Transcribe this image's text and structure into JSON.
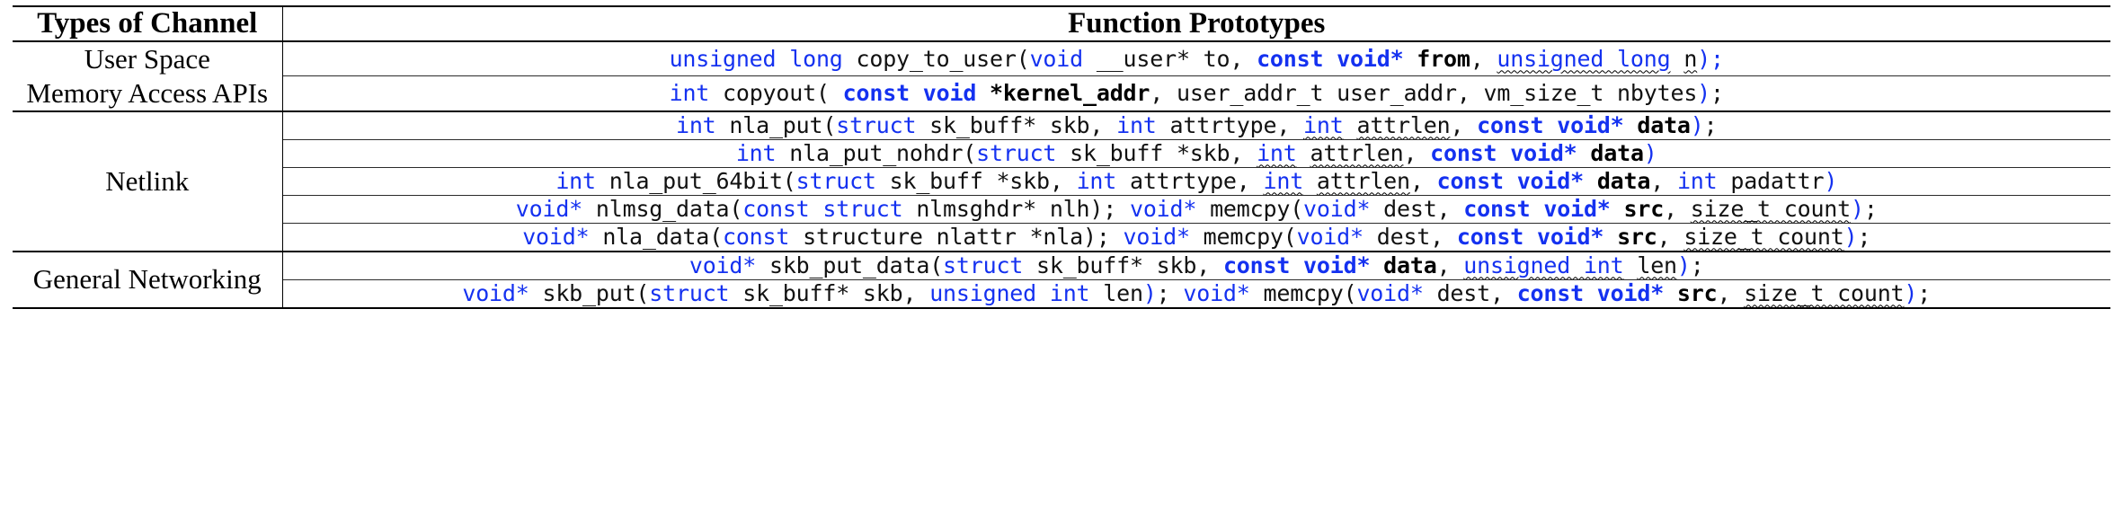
{
  "table": {
    "header": {
      "col_type": "Types of Channel",
      "col_proto": "Function Prototypes"
    },
    "colors": {
      "keyword_blue": "#1431f0",
      "text_black": "#111111",
      "rule": "#000000"
    },
    "groups": [
      {
        "label": "User Space\nMemory Access APIs",
        "label_line1": "User Space",
        "label_line2": "Memory Access APIs",
        "rows": [
          {
            "plain": "unsigned long copy_to_user(void __user* to, const void* from, unsigned long n);",
            "tokens": [
              {
                "t": "unsigned long ",
                "s": "kw"
              },
              {
                "t": "copy_to_user(",
                "s": "pl"
              },
              {
                "t": "void",
                "s": "kw"
              },
              {
                "t": " __user* to, ",
                "s": "pl"
              },
              {
                "t": "const void*",
                "s": "kwb"
              },
              {
                "t": " ",
                "s": "pl"
              },
              {
                "t": "from",
                "s": "bk"
              },
              {
                "t": ", ",
                "s": "pl"
              },
              {
                "t": "unsigned long",
                "s": "kw sq"
              },
              {
                "t": " ",
                "s": "pl"
              },
              {
                "t": "n",
                "s": "pl sq"
              },
              {
                "t": ");",
                "s": "kw"
              }
            ]
          },
          {
            "plain": "int copyout( const void *kernel_addr, user_addr_t user_addr, vm_size_t nbytes);",
            "tokens": [
              {
                "t": "int",
                "s": "kw"
              },
              {
                "t": " copyout( ",
                "s": "pl"
              },
              {
                "t": "const void",
                "s": "kwb"
              },
              {
                "t": " ",
                "s": "pl"
              },
              {
                "t": "*kernel_addr",
                "s": "bk"
              },
              {
                "t": ", user_addr_t user_addr, vm_size_t nbytes",
                "s": "pl"
              },
              {
                "t": ")",
                "s": "kw"
              },
              {
                "t": ";",
                "s": "pl"
              }
            ]
          }
        ]
      },
      {
        "label": "Netlink",
        "label_line1": "Netlink",
        "label_line2": "",
        "rows": [
          {
            "plain": "int nla_put(struct sk_buff* skb, int attrtype, int attrlen, const void* data);",
            "tokens": [
              {
                "t": "int",
                "s": "kw"
              },
              {
                "t": " nla_put(",
                "s": "pl"
              },
              {
                "t": "struct",
                "s": "kw"
              },
              {
                "t": " sk_buff* skb, ",
                "s": "pl"
              },
              {
                "t": "int",
                "s": "kw"
              },
              {
                "t": " attrtype, ",
                "s": "pl"
              },
              {
                "t": "int",
                "s": "kw sq"
              },
              {
                "t": " ",
                "s": "pl"
              },
              {
                "t": "attrlen",
                "s": "pl sq"
              },
              {
                "t": ", ",
                "s": "pl"
              },
              {
                "t": "const void*",
                "s": "kwb"
              },
              {
                "t": " ",
                "s": "pl"
              },
              {
                "t": "data",
                "s": "bk"
              },
              {
                "t": ")",
                "s": "kw"
              },
              {
                "t": ";",
                "s": "pl"
              }
            ]
          },
          {
            "plain": "int nla_put_nohdr(struct sk_buff *skb, int attrlen, const void* data)",
            "tokens": [
              {
                "t": "int",
                "s": "kw"
              },
              {
                "t": " nla_put_nohdr(",
                "s": "pl"
              },
              {
                "t": "struct",
                "s": "kw"
              },
              {
                "t": " sk_buff *skb, ",
                "s": "pl"
              },
              {
                "t": "int",
                "s": "kw sq"
              },
              {
                "t": " ",
                "s": "pl"
              },
              {
                "t": "attrlen",
                "s": "pl sq"
              },
              {
                "t": ", ",
                "s": "pl"
              },
              {
                "t": "const void*",
                "s": "kwb"
              },
              {
                "t": " ",
                "s": "pl"
              },
              {
                "t": "data",
                "s": "bk"
              },
              {
                "t": ")",
                "s": "kw"
              }
            ]
          },
          {
            "plain": "int nla_put_64bit(struct sk_buff *skb, int attrtype, int attrlen, const void* data, int padattr)",
            "tokens": [
              {
                "t": "int",
                "s": "kw"
              },
              {
                "t": " nla_put_64bit(",
                "s": "pl"
              },
              {
                "t": "struct",
                "s": "kw"
              },
              {
                "t": " sk_buff *skb, ",
                "s": "pl"
              },
              {
                "t": "int",
                "s": "kw"
              },
              {
                "t": " attrtype, ",
                "s": "pl"
              },
              {
                "t": "int",
                "s": "kw sq"
              },
              {
                "t": " ",
                "s": "pl"
              },
              {
                "t": "attrlen",
                "s": "pl sq"
              },
              {
                "t": ", ",
                "s": "pl"
              },
              {
                "t": "const void*",
                "s": "kwb"
              },
              {
                "t": " ",
                "s": "pl"
              },
              {
                "t": "data",
                "s": "bk"
              },
              {
                "t": ", ",
                "s": "pl"
              },
              {
                "t": "int",
                "s": "kw"
              },
              {
                "t": " padattr",
                "s": "pl"
              },
              {
                "t": ")",
                "s": "kw"
              }
            ]
          },
          {
            "plain": "void* nlmsg_data(const struct nlmsghdr* nlh); void* memcpy(void* dest, const void* src, size_t count);",
            "tokens": [
              {
                "t": "void*",
                "s": "kw"
              },
              {
                "t": " nlmsg_data(",
                "s": "pl"
              },
              {
                "t": "const struct",
                "s": "kw"
              },
              {
                "t": " nlmsghdr* nlh); ",
                "s": "pl"
              },
              {
                "t": "void*",
                "s": "kw"
              },
              {
                "t": " memcpy(",
                "s": "pl"
              },
              {
                "t": "void*",
                "s": "kw"
              },
              {
                "t": " dest, ",
                "s": "pl"
              },
              {
                "t": "const void*",
                "s": "kwb"
              },
              {
                "t": " ",
                "s": "pl"
              },
              {
                "t": "src",
                "s": "bk"
              },
              {
                "t": ", ",
                "s": "pl"
              },
              {
                "t": "size_t count",
                "s": "pl sq"
              },
              {
                "t": ")",
                "s": "kw"
              },
              {
                "t": ";",
                "s": "pl"
              }
            ]
          },
          {
            "plain": "void* nla_data(const structure nlattr *nla); void* memcpy(void* dest, const void* src, size_t count);",
            "tokens": [
              {
                "t": "void*",
                "s": "kw"
              },
              {
                "t": " nla_data(",
                "s": "pl"
              },
              {
                "t": "const",
                "s": "kw"
              },
              {
                "t": " structure nlattr *nla); ",
                "s": "pl"
              },
              {
                "t": "void*",
                "s": "kw"
              },
              {
                "t": " memcpy(",
                "s": "pl"
              },
              {
                "t": "void*",
                "s": "kw"
              },
              {
                "t": " dest, ",
                "s": "pl"
              },
              {
                "t": "const void*",
                "s": "kwb"
              },
              {
                "t": " ",
                "s": "pl"
              },
              {
                "t": "src",
                "s": "bk"
              },
              {
                "t": ", ",
                "s": "pl"
              },
              {
                "t": "size_t count",
                "s": "pl sq"
              },
              {
                "t": ")",
                "s": "kw"
              },
              {
                "t": ";",
                "s": "pl"
              }
            ]
          }
        ]
      },
      {
        "label": "General Networking",
        "label_line1": "General Networking",
        "label_line2": "",
        "rows": [
          {
            "plain": "void* skb_put_data(struct sk_buff* skb, const void* data, unsigned int len);",
            "tokens": [
              {
                "t": "void*",
                "s": "kw"
              },
              {
                "t": " skb_put_data(",
                "s": "pl"
              },
              {
                "t": "struct",
                "s": "kw"
              },
              {
                "t": " sk_buff* skb, ",
                "s": "pl"
              },
              {
                "t": "const void*",
                "s": "kwb"
              },
              {
                "t": " ",
                "s": "pl"
              },
              {
                "t": "data",
                "s": "bk"
              },
              {
                "t": ", ",
                "s": "pl"
              },
              {
                "t": "unsigned int",
                "s": "kw sq"
              },
              {
                "t": " ",
                "s": "pl"
              },
              {
                "t": "len",
                "s": "pl sq"
              },
              {
                "t": ")",
                "s": "kw"
              },
              {
                "t": ";",
                "s": "pl"
              }
            ]
          },
          {
            "plain": "void* skb_put(struct sk_buff* skb, unsigned int len); void* memcpy(void* dest, const void* src, size_t count);",
            "tokens": [
              {
                "t": "void*",
                "s": "kw"
              },
              {
                "t": " skb_put(",
                "s": "pl"
              },
              {
                "t": "struct",
                "s": "kw"
              },
              {
                "t": " sk_buff* skb, ",
                "s": "pl"
              },
              {
                "t": "unsigned int",
                "s": "kw"
              },
              {
                "t": " len",
                "s": "pl"
              },
              {
                "t": ")",
                "s": "kw"
              },
              {
                "t": "; ",
                "s": "pl"
              },
              {
                "t": "void*",
                "s": "kw"
              },
              {
                "t": " memcpy(",
                "s": "pl"
              },
              {
                "t": "void*",
                "s": "kw"
              },
              {
                "t": " dest, ",
                "s": "pl"
              },
              {
                "t": "const void*",
                "s": "kwb"
              },
              {
                "t": " ",
                "s": "pl"
              },
              {
                "t": "src",
                "s": "bk"
              },
              {
                "t": ", ",
                "s": "pl"
              },
              {
                "t": "size_t count",
                "s": "pl sq"
              },
              {
                "t": ")",
                "s": "kw"
              },
              {
                "t": ";",
                "s": "pl"
              }
            ]
          }
        ]
      }
    ]
  }
}
